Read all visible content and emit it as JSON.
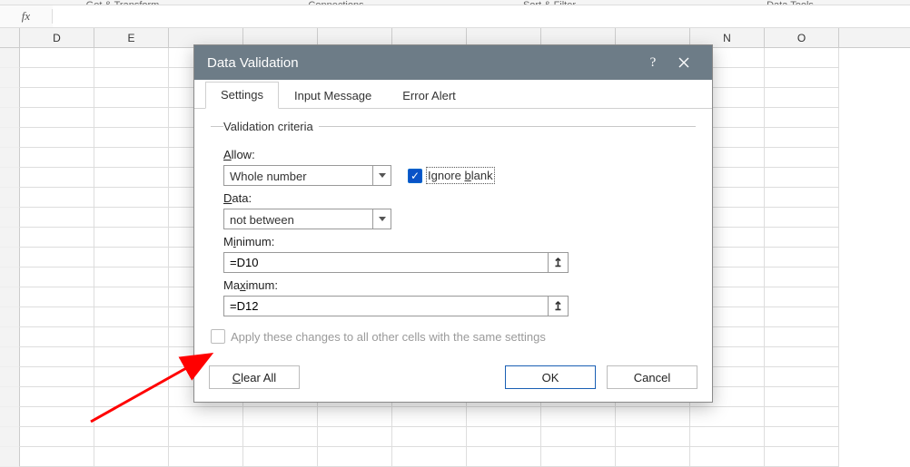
{
  "ribbon_groups": [
    "Get & Transform",
    "Connections",
    "Sort & Filter",
    "Data Tools"
  ],
  "formula_bar": {
    "fx": "fx",
    "value": ""
  },
  "columns": [
    "D",
    "E",
    "",
    "",
    "",
    "",
    "",
    "",
    "",
    "N",
    "O"
  ],
  "dialog": {
    "title": "Data Validation",
    "tabs": [
      {
        "label": "Settings",
        "active": true
      },
      {
        "label": "Input Message",
        "active": false
      },
      {
        "label": "Error Alert",
        "active": false
      }
    ],
    "criteria": {
      "legend": "Validation criteria",
      "allow_label_pre": "",
      "allow_label_u": "A",
      "allow_label_post": "llow:",
      "allow_value": "Whole number",
      "ignore_blank_checked": true,
      "ignore_blank_pre": "Ignore ",
      "ignore_blank_u": "b",
      "ignore_blank_post": "lank",
      "data_label_u": "D",
      "data_label_post": "ata:",
      "data_value": "not between",
      "min_pre": "M",
      "min_u": "i",
      "min_post": "nimum:",
      "min_value": "=D10",
      "max_pre": "Ma",
      "max_u": "x",
      "max_post": "imum:",
      "max_value": "=D12",
      "apply_pre": "A",
      "apply_u": "p",
      "apply_post": "ply these changes to all other cells with the same settings",
      "apply_checked": false
    },
    "buttons": {
      "clear_u": "C",
      "clear_post": "lear All",
      "ok": "OK",
      "cancel": "Cancel"
    }
  },
  "icons": {
    "collapse": "↥"
  }
}
